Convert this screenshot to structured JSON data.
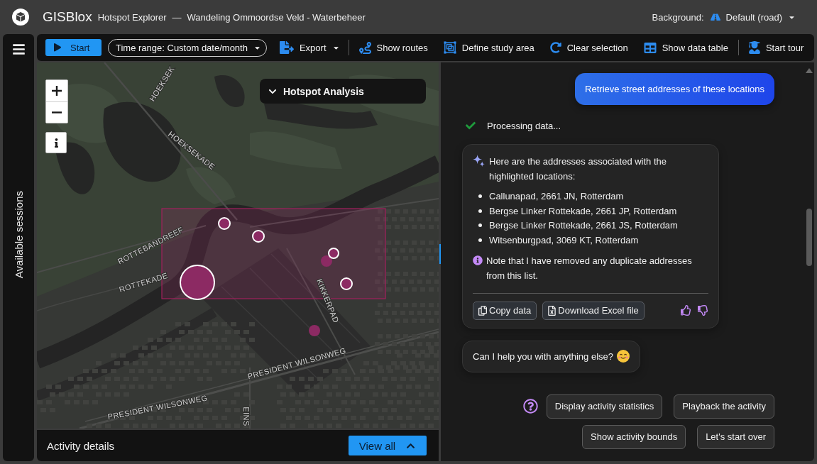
{
  "title_bar": {
    "app_name": "GISBlox",
    "module": "Hotspot Explorer",
    "separator": "—",
    "document": "Wandeling Ommoordse Veld - Waterbeheer",
    "background_label": "Background:",
    "background_value": "Default (road)"
  },
  "sidebar": {
    "label": "Available sessions"
  },
  "toolbar": {
    "start_button": "Start",
    "time_range": "Time range: Custom date/month",
    "groups": [
      [
        {
          "kind": "menu",
          "label": "Export"
        }
      ],
      [
        {
          "kind": "button",
          "label": "Show routes"
        },
        {
          "kind": "button",
          "label": "Define study area"
        },
        {
          "kind": "button",
          "label": "Clear selection"
        },
        {
          "kind": "button",
          "label": "Show data table"
        }
      ],
      [
        {
          "kind": "button",
          "label": "Start tour"
        }
      ]
    ]
  },
  "map": {
    "panel_title": "Hotspot Analysis",
    "expanded": false,
    "street_labels": [
      "HOEKSEK",
      "HOEKSEKADE",
      "ROTTEBANDREEF",
      "ROTTEKADE",
      "KIKKERPAD",
      "PRESIDENT WILSONWEG",
      "PRESIDENT WILSONWEG",
      "EINS"
    ],
    "markers": [
      {
        "selected": true
      },
      {
        "selected": true
      },
      {
        "selected": true
      },
      {
        "selected": false
      },
      {
        "selected": true
      },
      {
        "selected": true
      },
      {
        "selected": false
      }
    ]
  },
  "activity_bar": {
    "title": "Activity details",
    "button": "View all"
  },
  "chat": {
    "messages": [
      {
        "kind": "user",
        "text": "Retrieve street addresses of these locations"
      },
      {
        "kind": "status",
        "text": "Processing data...",
        "done": true
      },
      {
        "kind": "answer",
        "intro": "Here are the addresses associated with the highlighted locations:",
        "items": [
          "Callunapad, 2661 JN, Rotterdam",
          "Bergse Linker Rottekade, 2661 JP, Rotterdam",
          "Bergse Linker Rottekade, 2661 JS, Rotterdam",
          "Witsenburgpad, 3069 KT, Rotterdam"
        ],
        "note": "Note that I have removed any duplicate addresses from this list.",
        "actions": [
          "Copy data",
          "Download Excel file"
        ]
      },
      {
        "kind": "reply",
        "text": "Can I help you with anything else?"
      }
    ],
    "suggestions": [
      "Display activity statistics",
      "Playback the activity",
      "Show activity bounds",
      "Let's start over"
    ]
  }
}
